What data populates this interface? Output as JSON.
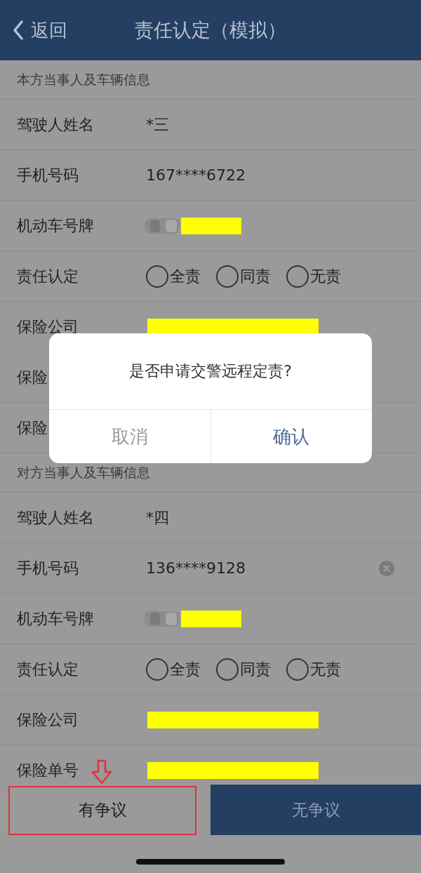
{
  "header": {
    "back": "返回",
    "title": "责任认定（模拟）"
  },
  "sections": [
    {
      "title": "本方当事人及车辆信息",
      "rows": [
        {
          "kind": "text",
          "label": "驾驶人姓名",
          "value": "*三"
        },
        {
          "kind": "text",
          "label": "手机号码",
          "value": "167****6722"
        },
        {
          "kind": "plate",
          "label": "机动车号牌"
        },
        {
          "kind": "radio",
          "label": "责任认定",
          "options": [
            {
              "label": "全责",
              "selected": false
            },
            {
              "label": "同责",
              "selected": false
            },
            {
              "label": "无责",
              "selected": false
            }
          ]
        },
        {
          "kind": "redacted",
          "label": "保险公司"
        },
        {
          "kind": "covered",
          "label": "保险"
        },
        {
          "kind": "covered",
          "label": "保险"
        }
      ]
    },
    {
      "title": "对方当事人及车辆信息",
      "rows": [
        {
          "kind": "text",
          "label": "驾驶人姓名",
          "value": "*四"
        },
        {
          "kind": "text",
          "label": "手机号码",
          "value": "136****9128",
          "clearable": true
        },
        {
          "kind": "plate",
          "label": "机动车号牌"
        },
        {
          "kind": "radio",
          "label": "责任认定",
          "options": [
            {
              "label": "全责",
              "selected": false
            },
            {
              "label": "同责",
              "selected": false
            },
            {
              "label": "无责",
              "selected": false
            }
          ]
        },
        {
          "kind": "redacted",
          "label": "保险公司"
        },
        {
          "kind": "redacted",
          "label": "保险单号"
        }
      ]
    }
  ],
  "footer": [
    {
      "label": "有争议",
      "kind": "secondary",
      "highlighted": true
    },
    {
      "label": "无争议",
      "kind": "primary"
    }
  ],
  "dialog": {
    "message": "是否申请交警远程定责?",
    "buttons": [
      {
        "label": "取消",
        "kind": "cancel"
      },
      {
        "label": "确认",
        "kind": "confirm"
      }
    ]
  }
}
